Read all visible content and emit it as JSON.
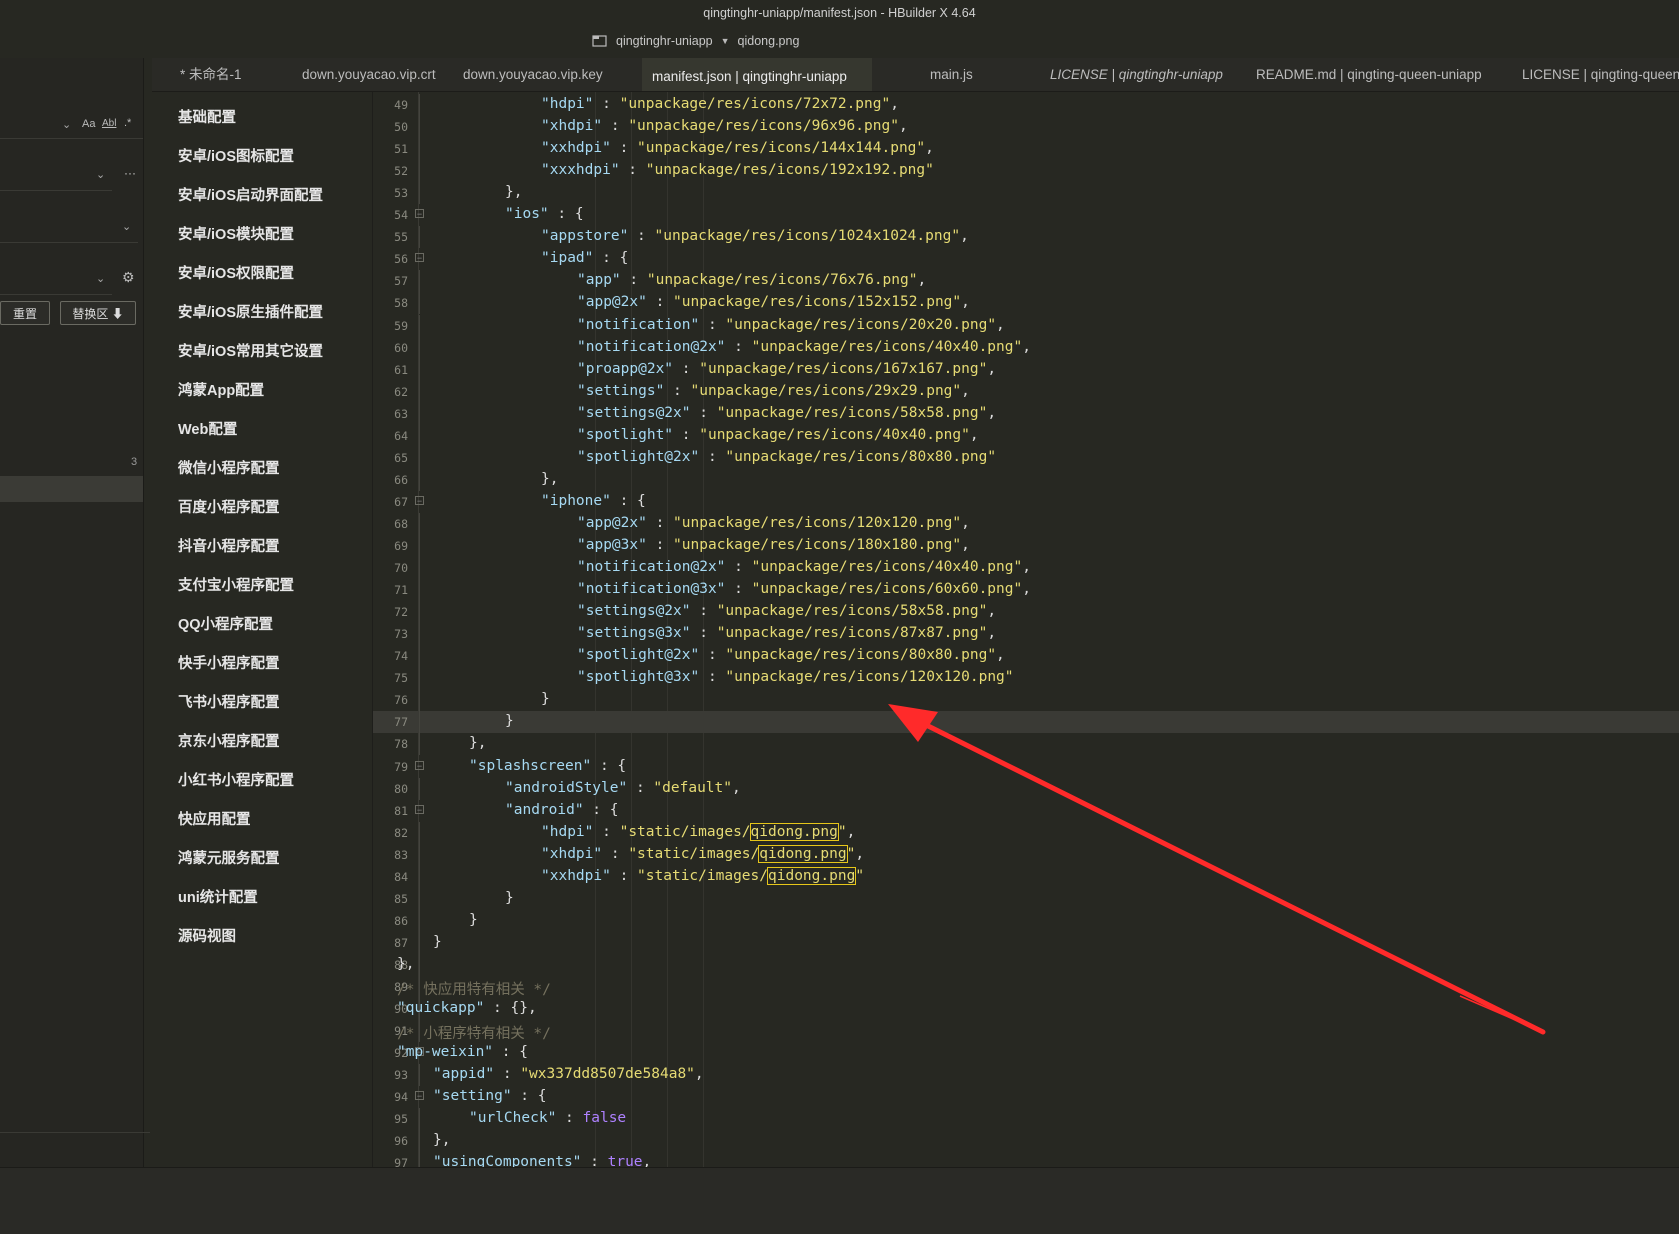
{
  "window": {
    "title": "qingtinghr-uniapp/manifest.json - HBuilder X 4.64",
    "project": "qingtinghr-uniapp",
    "file": "qidong.png"
  },
  "tabs": [
    {
      "label": "* 未命名-1"
    },
    {
      "label": "down.youyacao.vip.crt"
    },
    {
      "label": "down.youyacao.vip.key"
    },
    {
      "label": "manifest.json | qingtinghr-uniapp"
    },
    {
      "label": "main.js"
    },
    {
      "label": "LICENSE | qingtinghr-uniapp"
    },
    {
      "label": "README.md | qingting-queen-uniapp"
    },
    {
      "label": "LICENSE | qingting-queen-uniapp"
    }
  ],
  "search_panel": {
    "opt_case": "Aa",
    "opt_word": "Abl",
    "opt_regex": ".*",
    "more": "···",
    "reset_button": "重置",
    "replace_button": "替换区 ⬇",
    "result_count": "3"
  },
  "config_nav": [
    "基础配置",
    "安卓/iOS图标配置",
    "安卓/iOS启动界面配置",
    "安卓/iOS模块配置",
    "安卓/iOS权限配置",
    "安卓/iOS原生插件配置",
    "安卓/iOS常用其它设置",
    "鸿蒙App配置",
    "Web配置",
    "微信小程序配置",
    "百度小程序配置",
    "抖音小程序配置",
    "支付宝小程序配置",
    "QQ小程序配置",
    "快手小程序配置",
    "飞书小程序配置",
    "京东小程序配置",
    "小红书小程序配置",
    "快应用配置",
    "鸿蒙元服务配置",
    "uni统计配置",
    "源码视图"
  ],
  "code": [
    {
      "n": "49",
      "parts": [
        [
          "k",
          "\"hdpi\""
        ],
        [
          "p",
          " : "
        ],
        [
          "s",
          "\"unpackage/res/icons/72x72.png\""
        ],
        [
          "p",
          ","
        ]
      ]
    },
    {
      "n": "50",
      "parts": [
        [
          "k",
          "\"xhdpi\""
        ],
        [
          "p",
          " : "
        ],
        [
          "s",
          "\"unpackage/res/icons/96x96.png\""
        ],
        [
          "p",
          ","
        ]
      ]
    },
    {
      "n": "51",
      "parts": [
        [
          "k",
          "\"xxhdpi\""
        ],
        [
          "p",
          " : "
        ],
        [
          "s",
          "\"unpackage/res/icons/144x144.png\""
        ],
        [
          "p",
          ","
        ]
      ]
    },
    {
      "n": "52",
      "parts": [
        [
          "k",
          "\"xxxhdpi\""
        ],
        [
          "p",
          " : "
        ],
        [
          "s",
          "\"unpackage/res/icons/192x192.png\""
        ]
      ]
    },
    {
      "n": "53",
      "parts": [
        [
          "p",
          "},"
        ]
      ]
    },
    {
      "n": "54",
      "parts": [
        [
          "k",
          "\"ios\""
        ],
        [
          "p",
          " : {"
        ]
      ]
    },
    {
      "n": "55",
      "parts": [
        [
          "k",
          "\"appstore\""
        ],
        [
          "p",
          " : "
        ],
        [
          "s",
          "\"unpackage/res/icons/1024x1024.png\""
        ],
        [
          "p",
          ","
        ]
      ]
    },
    {
      "n": "56",
      "parts": [
        [
          "k",
          "\"ipad\""
        ],
        [
          "p",
          " : {"
        ]
      ]
    },
    {
      "n": "57",
      "parts": [
        [
          "k",
          "\"app\""
        ],
        [
          "p",
          " : "
        ],
        [
          "s",
          "\"unpackage/res/icons/76x76.png\""
        ],
        [
          "p",
          ","
        ]
      ]
    },
    {
      "n": "58",
      "parts": [
        [
          "k",
          "\"app@2x\""
        ],
        [
          "p",
          " : "
        ],
        [
          "s",
          "\"unpackage/res/icons/152x152.png\""
        ],
        [
          "p",
          ","
        ]
      ]
    },
    {
      "n": "59",
      "parts": [
        [
          "k",
          "\"notification\""
        ],
        [
          "p",
          " : "
        ],
        [
          "s",
          "\"unpackage/res/icons/20x20.png\""
        ],
        [
          "p",
          ","
        ]
      ]
    },
    {
      "n": "60",
      "parts": [
        [
          "k",
          "\"notification@2x\""
        ],
        [
          "p",
          " : "
        ],
        [
          "s",
          "\"unpackage/res/icons/40x40.png\""
        ],
        [
          "p",
          ","
        ]
      ]
    },
    {
      "n": "61",
      "parts": [
        [
          "k",
          "\"proapp@2x\""
        ],
        [
          "p",
          " : "
        ],
        [
          "s",
          "\"unpackage/res/icons/167x167.png\""
        ],
        [
          "p",
          ","
        ]
      ]
    },
    {
      "n": "62",
      "parts": [
        [
          "k",
          "\"settings\""
        ],
        [
          "p",
          " : "
        ],
        [
          "s",
          "\"unpackage/res/icons/29x29.png\""
        ],
        [
          "p",
          ","
        ]
      ]
    },
    {
      "n": "63",
      "parts": [
        [
          "k",
          "\"settings@2x\""
        ],
        [
          "p",
          " : "
        ],
        [
          "s",
          "\"unpackage/res/icons/58x58.png\""
        ],
        [
          "p",
          ","
        ]
      ]
    },
    {
      "n": "64",
      "parts": [
        [
          "k",
          "\"spotlight\""
        ],
        [
          "p",
          " : "
        ],
        [
          "s",
          "\"unpackage/res/icons/40x40.png\""
        ],
        [
          "p",
          ","
        ]
      ]
    },
    {
      "n": "65",
      "parts": [
        [
          "k",
          "\"spotlight@2x\""
        ],
        [
          "p",
          " : "
        ],
        [
          "s",
          "\"unpackage/res/icons/80x80.png\""
        ]
      ]
    },
    {
      "n": "66",
      "parts": [
        [
          "p",
          "},"
        ]
      ]
    },
    {
      "n": "67",
      "parts": [
        [
          "k",
          "\"iphone\""
        ],
        [
          "p",
          " : {"
        ]
      ]
    },
    {
      "n": "68",
      "parts": [
        [
          "k",
          "\"app@2x\""
        ],
        [
          "p",
          " : "
        ],
        [
          "s",
          "\"unpackage/res/icons/120x120.png\""
        ],
        [
          "p",
          ","
        ]
      ]
    },
    {
      "n": "69",
      "parts": [
        [
          "k",
          "\"app@3x\""
        ],
        [
          "p",
          " : "
        ],
        [
          "s",
          "\"unpackage/res/icons/180x180.png\""
        ],
        [
          "p",
          ","
        ]
      ]
    },
    {
      "n": "70",
      "parts": [
        [
          "k",
          "\"notification@2x\""
        ],
        [
          "p",
          " : "
        ],
        [
          "s",
          "\"unpackage/res/icons/40x40.png\""
        ],
        [
          "p",
          ","
        ]
      ]
    },
    {
      "n": "71",
      "parts": [
        [
          "k",
          "\"notification@3x\""
        ],
        [
          "p",
          " : "
        ],
        [
          "s",
          "\"unpackage/res/icons/60x60.png\""
        ],
        [
          "p",
          ","
        ]
      ]
    },
    {
      "n": "72",
      "parts": [
        [
          "k",
          "\"settings@2x\""
        ],
        [
          "p",
          " : "
        ],
        [
          "s",
          "\"unpackage/res/icons/58x58.png\""
        ],
        [
          "p",
          ","
        ]
      ]
    },
    {
      "n": "73",
      "parts": [
        [
          "k",
          "\"settings@3x\""
        ],
        [
          "p",
          " : "
        ],
        [
          "s",
          "\"unpackage/res/icons/87x87.png\""
        ],
        [
          "p",
          ","
        ]
      ]
    },
    {
      "n": "74",
      "parts": [
        [
          "k",
          "\"spotlight@2x\""
        ],
        [
          "p",
          " : "
        ],
        [
          "s",
          "\"unpackage/res/icons/80x80.png\""
        ],
        [
          "p",
          ","
        ]
      ]
    },
    {
      "n": "75",
      "parts": [
        [
          "k",
          "\"spotlight@3x\""
        ],
        [
          "p",
          " : "
        ],
        [
          "s",
          "\"unpackage/res/icons/120x120.png\""
        ]
      ]
    },
    {
      "n": "76",
      "parts": [
        [
          "p",
          "}"
        ]
      ]
    },
    {
      "n": "77",
      "parts": [
        [
          "p",
          "}"
        ]
      ]
    },
    {
      "n": "78",
      "parts": [
        [
          "p",
          "},"
        ]
      ]
    },
    {
      "n": "79",
      "parts": [
        [
          "k",
          "\"splashscreen\""
        ],
        [
          "p",
          " : {"
        ]
      ]
    },
    {
      "n": "80",
      "parts": [
        [
          "k",
          "\"androidStyle\""
        ],
        [
          "p",
          " : "
        ],
        [
          "s",
          "\"default\""
        ],
        [
          "p",
          ","
        ]
      ]
    },
    {
      "n": "81",
      "parts": [
        [
          "k",
          "\"android\""
        ],
        [
          "p",
          " : {"
        ]
      ]
    },
    {
      "n": "82",
      "parts": [
        [
          "k",
          "\"hdpi\""
        ],
        [
          "p",
          " : "
        ],
        [
          "s",
          "\"static/images/"
        ],
        [
          "h",
          "qidong.png"
        ],
        [
          "s",
          "\""
        ],
        [
          "p",
          ","
        ]
      ]
    },
    {
      "n": "83",
      "parts": [
        [
          "k",
          "\"xhdpi\""
        ],
        [
          "p",
          " : "
        ],
        [
          "s",
          "\"static/images/"
        ],
        [
          "h",
          "qidong.png"
        ],
        [
          "s",
          "\""
        ],
        [
          "p",
          ","
        ]
      ]
    },
    {
      "n": "84",
      "parts": [
        [
          "k",
          "\"xxhdpi\""
        ],
        [
          "p",
          " : "
        ],
        [
          "s",
          "\"static/images/"
        ],
        [
          "h",
          "qidong.png"
        ],
        [
          "s",
          "\""
        ]
      ]
    },
    {
      "n": "85",
      "parts": [
        [
          "p",
          "}"
        ]
      ]
    },
    {
      "n": "86",
      "parts": [
        [
          "p",
          "}"
        ]
      ]
    },
    {
      "n": "87",
      "parts": [
        [
          "p",
          "}"
        ]
      ]
    },
    {
      "n": "88",
      "parts": [
        [
          "p",
          "},"
        ]
      ]
    },
    {
      "n": "89",
      "parts": [
        [
          "c",
          "/* 快应用特有相关 */"
        ]
      ]
    },
    {
      "n": "90",
      "parts": [
        [
          "k",
          "\"quickapp\""
        ],
        [
          "p",
          " : {},"
        ]
      ]
    },
    {
      "n": "91",
      "parts": [
        [
          "c",
          "/* 小程序特有相关 */"
        ]
      ]
    },
    {
      "n": "92",
      "parts": [
        [
          "k",
          "\"mp-weixin\""
        ],
        [
          "p",
          " : {"
        ]
      ]
    },
    {
      "n": "93",
      "parts": [
        [
          "k",
          "\"appid\""
        ],
        [
          "p",
          " : "
        ],
        [
          "s",
          "\"wx337dd8507de584a8\""
        ],
        [
          "p",
          ","
        ]
      ]
    },
    {
      "n": "94",
      "parts": [
        [
          "k",
          "\"setting\""
        ],
        [
          "p",
          " : {"
        ]
      ]
    },
    {
      "n": "95",
      "parts": [
        [
          "k",
          "\"urlCheck\""
        ],
        [
          "p",
          " : "
        ],
        [
          "b",
          "false"
        ]
      ]
    },
    {
      "n": "96",
      "parts": [
        [
          "p",
          "},"
        ]
      ]
    },
    {
      "n": "97",
      "parts": [
        [
          "k",
          "\"usingComponents\""
        ],
        [
          "p",
          " : "
        ],
        [
          "b",
          "true"
        ],
        [
          "p",
          ","
        ]
      ]
    }
  ],
  "colors": {
    "background": "#272822",
    "key": "#a6d9f2",
    "string": "#e6db74",
    "comment": "#75715e",
    "boolean": "#ae81ff",
    "highlight_border": "#e6c619",
    "annotation_arrow": "#ff2a2a"
  }
}
